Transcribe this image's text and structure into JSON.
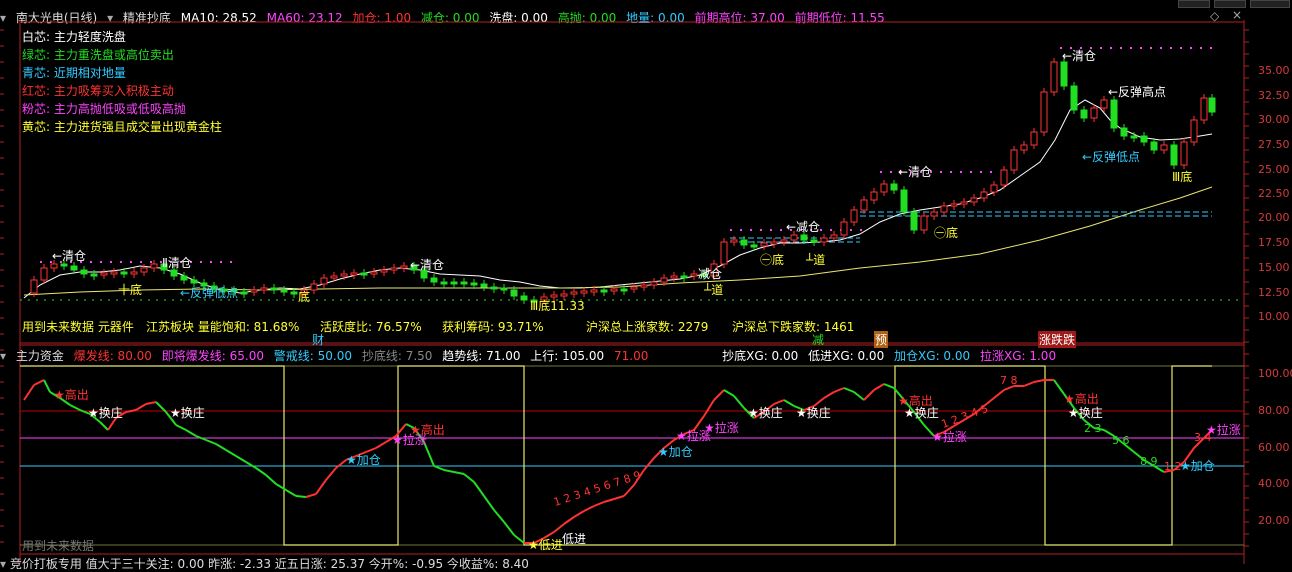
{
  "colors": {
    "red": "#ff3232",
    "green": "#22dd22",
    "white": "#ffffff",
    "cyan": "#33ccff",
    "magenta": "#ff44ff",
    "yellow": "#ffff33",
    "axis": "#d23c3c",
    "hline": "#c00000"
  },
  "top_header": {
    "title": "南大光电(日线)",
    "indicator": "精准抄底",
    "ma10": "MA10: 28.52",
    "ma60": "MA60: 23.12",
    "jiacang": "加仓: 1.00",
    "jiancang": "减仓: 0.00",
    "xipan": "洗盘: 0.00",
    "gaopao": "高抛: 0.00",
    "diliang": "地量: 0.00",
    "qianqi_high": "前期高位: 37.00",
    "qianqi_low": "前期低位: 11.55"
  },
  "legend": [
    {
      "text": "白芯:  主力轻度洗盘",
      "color": "#ffffff"
    },
    {
      "text": "绿芯:  主力重洗盘或高位卖出",
      "color": "#22dd22"
    },
    {
      "text": "青芯:  近期相对地量",
      "color": "#33ccff"
    },
    {
      "text": "红芯:  主力吸筹买入积极主动",
      "color": "#ff3232"
    },
    {
      "text": "粉芯:  主力高抛低吸或低吸高抛",
      "color": "#ff44ff"
    },
    {
      "text": "黄芯:  主力进货强且成交量出现黄金柱",
      "color": "#ffff33"
    }
  ],
  "price_axis": [
    "35.00",
    "32.50",
    "30.00",
    "27.50",
    "25.00",
    "22.50",
    "20.00",
    "17.50",
    "15.00",
    "12.50",
    "10.00"
  ],
  "price_annotations": {
    "qingcang1": "←清仓",
    "di1": "十底",
    "qingcang2": "Ⅱ清仓",
    "fantan_di1": "←反弹低点",
    "di2": "底",
    "qingcang3": "←清仓",
    "di_low": "Ⅲ底11.33",
    "jiancang1": "减仓",
    "dao1": "┴道",
    "jiancang2": "←减仓",
    "di3": "㊀底",
    "dao2": "┴道",
    "qingcang4": "←清仓",
    "di4": "㊀底",
    "qingcang5": "←清仓",
    "fantan_high": "←反弹高点",
    "fantan_di2": "←反弹低点",
    "di5": "Ⅲ底"
  },
  "mid_bar": {
    "text1": "用到未来数据 元器件",
    "text2": "江苏板块 量能饱和: 81.68%",
    "active": "活跃度比: 76.57%",
    "chips": "获利筹码: 93.71%",
    "up": "沪深总上涨家数: 2279",
    "down": "沪深总下跌家数: 1461",
    "cai": "财",
    "jian": "减",
    "yu": "预",
    "zhangting": "涨跌跌"
  },
  "lower_header": {
    "name": "主力资金",
    "baofa": "爆发线: 80.00",
    "jijiang": "即将爆发线: 65.00",
    "jingjie": "警戒线: 50.00",
    "chaodi": "抄底线: 7.50",
    "qushi": "趋势线: 71.00",
    "shangxing": "上行: 105.00",
    "v71": "71.00",
    "chaodi_xg": "抄底XG: 0.00",
    "dijin_xg": "低进XG: 0.00",
    "jiacang_xg": "加仓XG: 0.00",
    "lazhang_xg": "拉涨XG: 1.00"
  },
  "lower_axis": [
    "100.00",
    "80.00",
    "60.00",
    "40.00",
    "20.00"
  ],
  "lower_annotations": {
    "gaochu1": "★高出",
    "huanzhuang1": "★换庄",
    "huanzhuang2": "★换庄",
    "jiacang1": "★加仓",
    "lazhang1": "★拉涨",
    "gaochu2": "★高出",
    "dijin": "★低进",
    "dijin2": "低进",
    "jiacang2": "★加仓",
    "lazhang2": "★拉涨",
    "lazhang3": "★拉涨",
    "huanzhuang3": "★换庄",
    "huanzhuang4": "★换庄",
    "gaochu3": "★高出",
    "huanzhuang5": "★换庄",
    "lazhang4": "★拉涨",
    "gaochu4": "★高出",
    "huanzhuang6": "★换庄",
    "jiacang3": "★加仓",
    "lazhang5": "★拉涨",
    "seq1": "1 2 3 4 5 6 7 8 9",
    "seq2": "1 2 3 4 5",
    "seq3": "7 8",
    "seq4": "2 3",
    "seq5": "5 6",
    "seq6": "8 9",
    "seq7": "1 2",
    "seq8": "3 4"
  },
  "watermark": "用到未来数据",
  "bottom_bar": "竞价打板专用  值大于三十关注: 0.00  昨涨: -2.33  近五日涨: 25.37  今开%: -0.95  今收益%: 8.40"
}
